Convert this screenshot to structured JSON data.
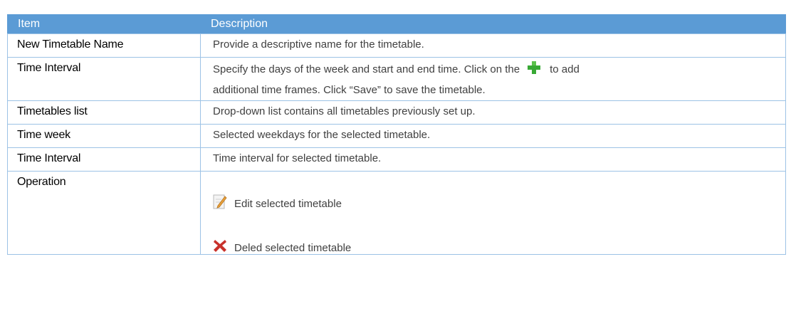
{
  "table": {
    "headers": {
      "item": "Item",
      "description": "Description"
    },
    "rows": [
      {
        "item": "New Timetable Name",
        "description": "Provide a descriptive name for the timetable."
      },
      {
        "item": "Time Interval",
        "description_part1": "Specify the days of the week and start and end time. Click on the",
        "icon": "plus-icon",
        "description_part2": "to add",
        "description_line2": "additional time frames. Click “Save” to save the timetable."
      },
      {
        "item": "Timetables list",
        "description": "Drop-down list contains all timetables previously set up."
      },
      {
        "item": "Time week",
        "description": "Selected weekdays for the selected timetable."
      },
      {
        "item": "Time Interval",
        "description": "Time interval for selected timetable."
      },
      {
        "item": "Operation",
        "operations": [
          {
            "icon": "edit-icon",
            "label": "Edit selected timetable"
          },
          {
            "icon": "delete-icon",
            "label": "Deled selected timetable"
          }
        ]
      }
    ]
  },
  "colors": {
    "header_bg": "#5b9bd5",
    "border": "#9cc2e5",
    "plus": "#39a935",
    "delete": "#c8312b"
  }
}
